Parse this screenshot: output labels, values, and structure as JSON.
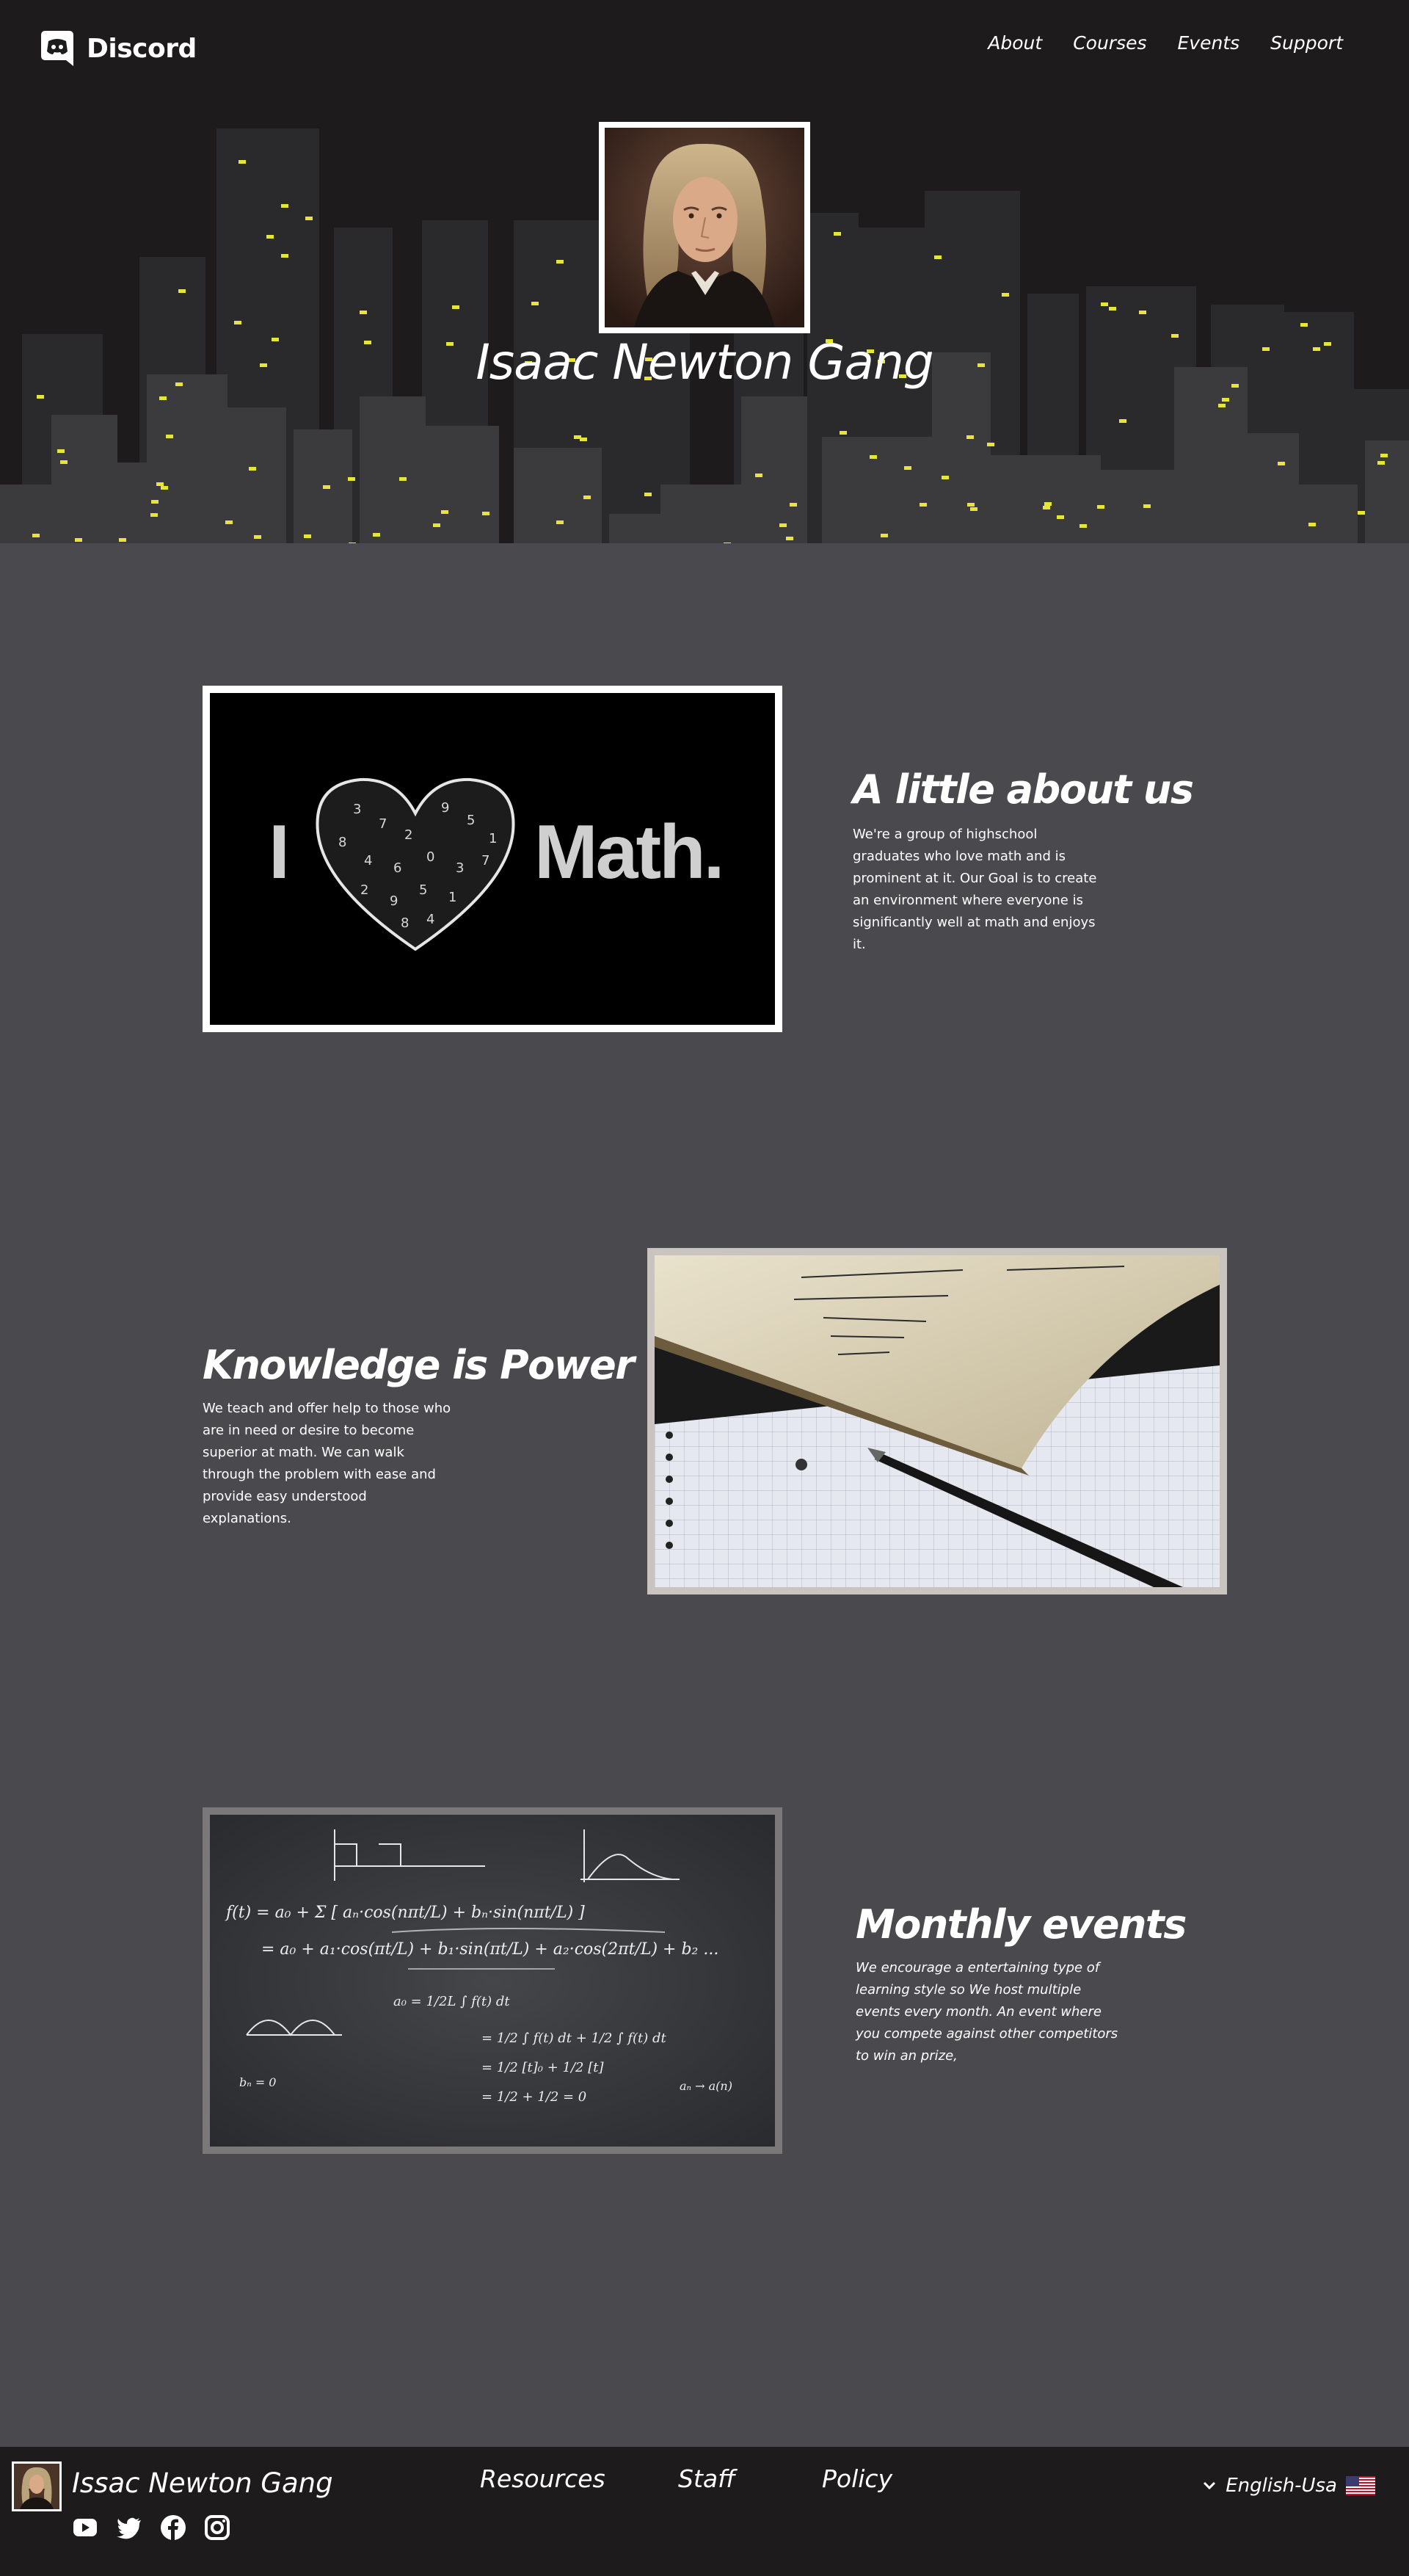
{
  "header": {
    "logo_text": "Discord",
    "logo_icon": "discord-icon",
    "nav": [
      {
        "label": "About"
      },
      {
        "label": "Courses"
      },
      {
        "label": "Events"
      },
      {
        "label": "Support"
      }
    ]
  },
  "hero": {
    "title": "Isaac Newton Gang",
    "portrait": "portrait-isaac-newton"
  },
  "sections": [
    {
      "title": "A little about us",
      "text": "We're a group of highschool graduates who love math and is prominent at it. Our Goal is to create an environment where everyone is significantly well at math and enjoys it.",
      "image": {
        "left_text": "I",
        "right_text": "Math.",
        "symbol": "heart-icon"
      }
    },
    {
      "title": "Knowledge is Power",
      "text": "We teach and offer help to those who are in need or desire to become superior at math. We can walk through the problem with ease and provide easy understood explanations.",
      "image": {
        "symbol": "notebook-and-pen"
      }
    },
    {
      "title": "Monthly events",
      "text": "We encourage a entertaining type of learning style so We host multiple events every month. An event where you compete against other competitors to win an prize,",
      "image": {
        "symbol": "chalkboard-equations"
      }
    }
  ],
  "footer": {
    "name": "Issac Newton Gang",
    "social": [
      "youtube-icon",
      "twitter-icon",
      "facebook-icon",
      "instagram-icon"
    ],
    "links": [
      {
        "label": "Resources"
      },
      {
        "label": "Staff"
      },
      {
        "label": "Policy"
      }
    ],
    "language": "English-Usa",
    "flag": "us-flag-icon"
  },
  "colors": {
    "hero_bg": "#1e1b1c",
    "page_bg": "#4a494d",
    "window_light": "#e8e53a",
    "footer_bg": "#1e1b1c"
  }
}
